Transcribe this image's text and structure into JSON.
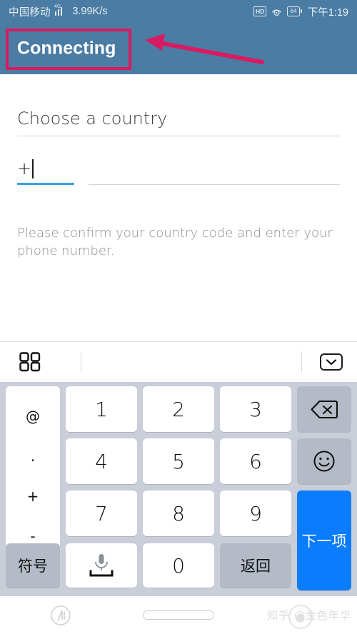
{
  "status_bar": {
    "carrier": "中国移动",
    "network_type": "4G",
    "data_speed": "3.99K/s",
    "hd_badge": "HD",
    "eye_icon": "eye-care-icon",
    "battery_level": "64",
    "time": "下午1:19"
  },
  "app_bar": {
    "title": "Connecting",
    "background_color": "#4b7ca4"
  },
  "annotation": {
    "box_color": "#d81b60",
    "arrow_color": "#d81b60",
    "target": "Connecting"
  },
  "form": {
    "country_field": {
      "placeholder": "Choose a country",
      "value": ""
    },
    "country_code_field": {
      "value": "+",
      "focused": true,
      "focus_color": "#3ba0dd"
    },
    "phone_field": {
      "value": "",
      "placeholder": ""
    },
    "hint": "Please confirm your country code and enter your phone number.",
    "next_button": {
      "icon": "arrow-right-icon",
      "color": "#5ca0d8"
    }
  },
  "keyboard": {
    "toolbar": {
      "grid_icon": "grid-apps-icon",
      "collapse_icon": "chevron-down-icon"
    },
    "background_color": "#c9ced9",
    "symbol_column": [
      "@",
      ".",
      "+",
      "-"
    ],
    "rows": [
      [
        {
          "label": "1",
          "style": "white"
        },
        {
          "label": "2",
          "style": "white"
        },
        {
          "label": "3",
          "style": "white"
        },
        {
          "label": "backspace-icon",
          "style": "gray"
        }
      ],
      [
        {
          "label": "4",
          "style": "white"
        },
        {
          "label": "5",
          "style": "white"
        },
        {
          "label": "6",
          "style": "white"
        },
        {
          "label": "emoji-icon",
          "style": "gray"
        }
      ],
      [
        {
          "label": "7",
          "style": "white"
        },
        {
          "label": "8",
          "style": "white"
        },
        {
          "label": "9",
          "style": "white"
        },
        {
          "label": "下一项",
          "style": "blue"
        }
      ],
      [
        {
          "label": "符号",
          "style": "gray"
        },
        {
          "label": "microphone-icon",
          "style": "white"
        },
        {
          "label": "0",
          "style": "white"
        },
        {
          "label": "返回",
          "style": "gray"
        }
      ]
    ],
    "keys": {
      "k1": "1",
      "k2": "2",
      "k3": "3",
      "k4": "4",
      "k5": "5",
      "k6": "6",
      "k7": "7",
      "k8": "8",
      "k9": "9",
      "k0": "0",
      "symbols": "符号",
      "back": "返回",
      "next": "下一项",
      "sym_at": "@",
      "sym_dot": ".",
      "sym_plus": "+",
      "sym_minus": "-"
    }
  },
  "nav_bar": {
    "back_icon": "back-navigation-icon",
    "home_icon": "home-pill-icon",
    "watermark": "知乎 @金色年华",
    "watermark_text_left": "知乎",
    "watermark_text_right": "金色年华"
  }
}
